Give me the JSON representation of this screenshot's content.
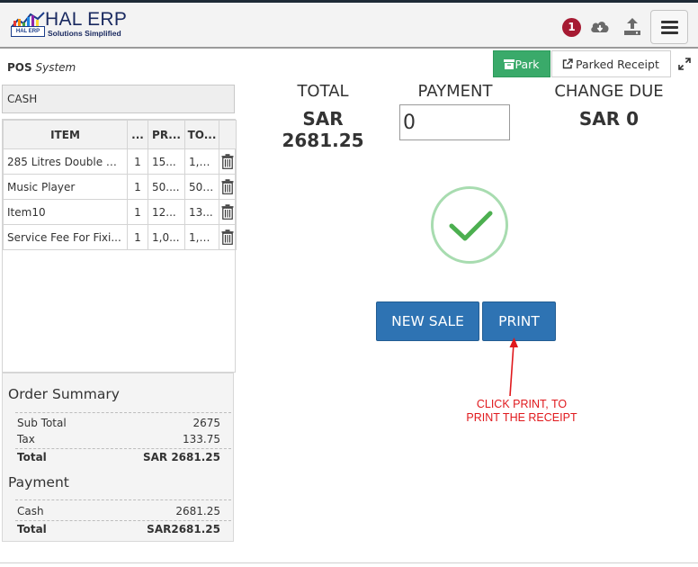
{
  "header": {
    "logo_title": "HAL ERP",
    "logo_tagline": "Solutions Simplified",
    "logo_mark_text": "HAL ERP",
    "notification_count": "1",
    "icons": [
      "cloud-download-icon",
      "upload-icon",
      "hamburger-menu-icon"
    ]
  },
  "subbar": {
    "module": "POS",
    "module_suffix": "System",
    "park_label": "Park",
    "parked_receipt_label": "Parked Receipt"
  },
  "customer": {
    "value": "CASH"
  },
  "items_table": {
    "headers": [
      "ITEM",
      "...",
      "PR...",
      "TO..."
    ],
    "rows": [
      {
        "item": "285 Litres Double D...",
        "qty": "1",
        "price": "15...",
        "total": "1,5..."
      },
      {
        "item": "Music Player",
        "qty": "1",
        "price": "50....",
        "total": "50...."
      },
      {
        "item": "Item10",
        "qty": "1",
        "price": "12...",
        "total": "13..."
      },
      {
        "item": "Service Fee For Fixi...",
        "qty": "1",
        "price": "1,0...",
        "total": "1,0..."
      }
    ]
  },
  "order_summary": {
    "title": "Order Summary",
    "sub_total_label": "Sub Total",
    "sub_total": "2675",
    "tax_label": "Tax",
    "tax": "133.75",
    "total_label": "Total",
    "total": "SAR 2681.25"
  },
  "payment_summary": {
    "title": "Payment",
    "cash_label": "Cash",
    "cash": "2681.25",
    "total_label": "Total",
    "total": "SAR2681.25"
  },
  "checkout": {
    "total_label": "TOTAL",
    "total_value": "SAR 2681.25",
    "payment_label": "PAYMENT",
    "payment_value": "0",
    "change_label": "CHANGE DUE",
    "change_value": "SAR 0",
    "new_sale_label": "NEW SALE",
    "print_label": "PRINT"
  },
  "annotation": {
    "line1": "CLICK PRINT, TO",
    "line2": "PRINT THE RECEIPT"
  },
  "colors": {
    "primary_button": "#2e73b3",
    "park_button": "#3aaa6a",
    "success_check": "#4caf50",
    "badge": "#a61a32",
    "annotation": "#e0191d"
  }
}
